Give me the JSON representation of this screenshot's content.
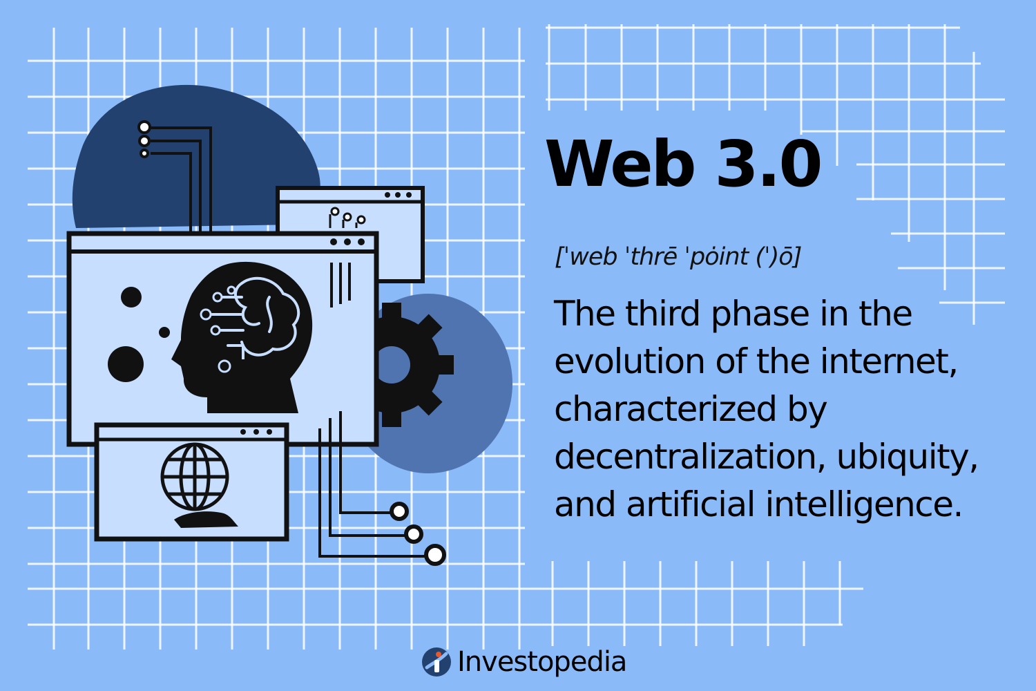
{
  "title": "Web 3.0",
  "pronunciation": "[ˈweb ˈthrē ˈpȯint (ˈ)ō]",
  "definition": "The third phase in the evolution of the internet, characterized by decentralization, ubiquity, and artificial intelligence.",
  "brand": {
    "name": "Investopedia",
    "logo_icon": "investopedia-logo-icon"
  },
  "illustration": {
    "icons": [
      "brain-head-icon",
      "gear-icon",
      "globe-hand-icon",
      "circuit-lines-icon",
      "window-dots-icon"
    ]
  },
  "colors": {
    "background": "#8bbaf8",
    "grid": "#ffffff",
    "blob_dark": "#23416f",
    "blob_mid": "#4f74b0",
    "window_fill": "#c8deff",
    "ink": "#111111",
    "logo_accent": "#e8572a"
  }
}
